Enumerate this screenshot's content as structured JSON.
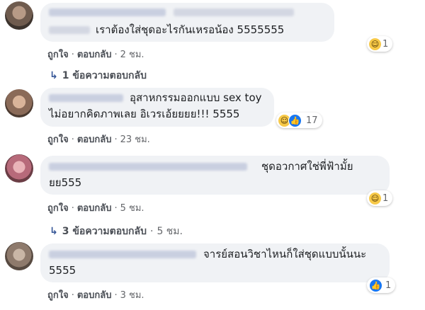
{
  "comments": [
    {
      "text_lines": [
        "เราต้องใส่ชุดอะไรกันเหรอน้อง 5555555"
      ],
      "like_label": "ถูกใจ",
      "reply_label": "ตอบกลับ",
      "time": "2 ชม.",
      "reaction_count": "1",
      "reaction_icons": [
        "haha-icon"
      ],
      "replies_label": "1 ข้อความตอบกลับ",
      "replies_time": ""
    },
    {
      "text_lines": [
        "อุสาหกรรมออกแบบ sex toy",
        "ไม่อยากคิดภาพเลย อิเวรเอ้ยยยย!!! 5555"
      ],
      "like_label": "ถูกใจ",
      "reply_label": "ตอบกลับ",
      "time": "23 ชม.",
      "reaction_count": "17",
      "reaction_icons": [
        "haha-icon",
        "like-icon"
      ]
    },
    {
      "text_lines": [
        "ชุดอวกาศใช่พี่ฟ้ามั้ย",
        "ยย555"
      ],
      "like_label": "ถูกใจ",
      "reply_label": "ตอบกลับ",
      "time": "5 ชม.",
      "reaction_count": "1",
      "reaction_icons": [
        "haha-icon"
      ],
      "replies_label": "3 ข้อความตอบกลับ",
      "replies_time": "5 ชม."
    },
    {
      "text_lines": [
        "จารย์สอนวิชาไหนก็ใส่ชุดแบบนั้นนะ",
        "5555"
      ],
      "like_label": "ถูกใจ",
      "reply_label": "ตอบกลับ",
      "time": "3 ชม.",
      "reaction_count": "1",
      "reaction_icons": [
        "like-icon"
      ]
    }
  ],
  "colors": {
    "bubble": "#f0f2f5",
    "link": "#385898",
    "meta": "#65676b"
  }
}
